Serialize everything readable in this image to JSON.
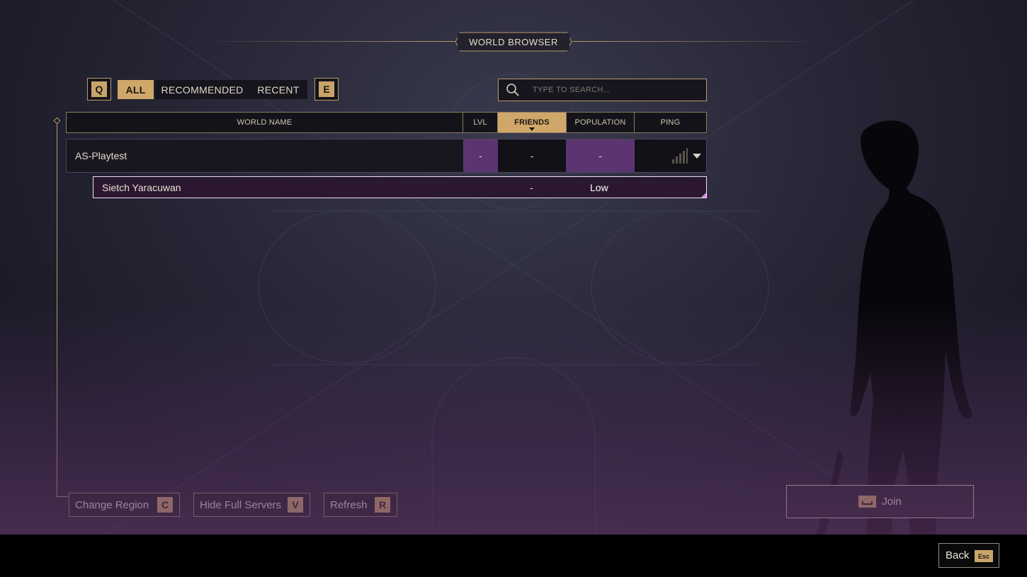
{
  "header": {
    "title": "WORLD BROWSER"
  },
  "filters": {
    "prev_key": "Q",
    "next_key": "E",
    "tabs": [
      {
        "label": "ALL",
        "active": true
      },
      {
        "label": "RECOMMENDED",
        "active": false
      },
      {
        "label": "RECENT",
        "active": false
      }
    ]
  },
  "search": {
    "placeholder": "TYPE TO SEARCH..."
  },
  "table": {
    "columns": [
      "WORLD NAME",
      "LVL",
      "FRIENDS",
      "POPULATION",
      "PING"
    ],
    "sorted_column": "FRIENDS",
    "group_row": {
      "name": "AS-Playtest",
      "lvl": "-",
      "friends": "-",
      "population": "-",
      "ping_icon": "signal-bars-icon"
    },
    "server_row": {
      "name": "Sietch Yaracuwan",
      "friends": "-",
      "population": "Low"
    }
  },
  "actions": [
    {
      "label": "Change Region",
      "key": "C"
    },
    {
      "label": "Hide Full Servers",
      "key": "V"
    },
    {
      "label": "Refresh",
      "key": "R"
    }
  ],
  "join": {
    "label": "Join",
    "key_icon": "spacebar-icon"
  },
  "back": {
    "label": "Back",
    "key": "Esc"
  },
  "colors": {
    "accent": "#c9a46a",
    "highlight_purple": "#5c3472",
    "selected_row": "#2c1730"
  }
}
